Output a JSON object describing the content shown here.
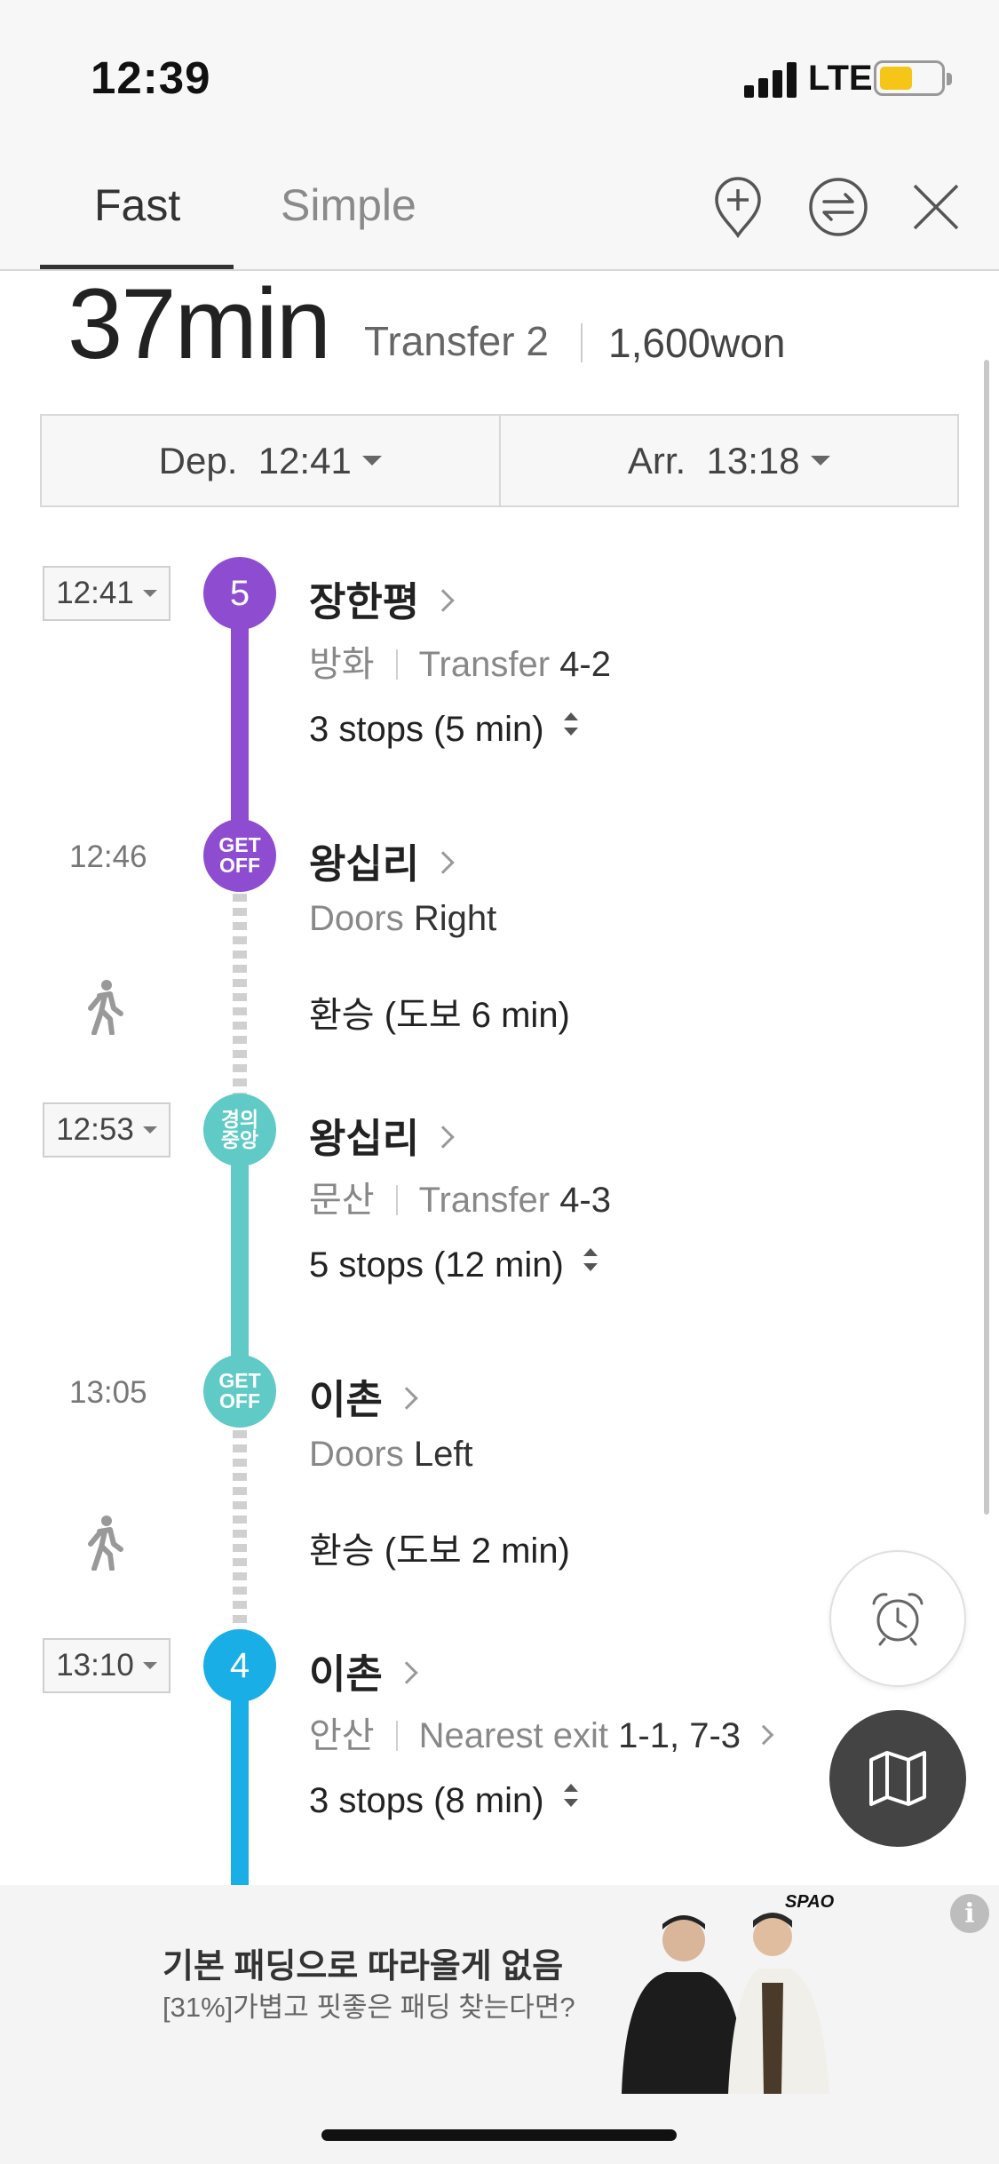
{
  "status_bar": {
    "time": "12:39",
    "network": "LTE"
  },
  "header": {
    "tabs": [
      {
        "label": "Fast"
      },
      {
        "label": "Simple"
      }
    ],
    "icons": [
      "add-location-icon",
      "swap-icon",
      "close-icon"
    ]
  },
  "summary": {
    "duration": "37min",
    "transfer": "Transfer 2",
    "fare": "1,600won"
  },
  "dep_arr": {
    "dep_label": "Dep.",
    "dep_time": "12:41",
    "arr_label": "Arr.",
    "arr_time": "13:18"
  },
  "colors": {
    "line5": "#8e4dd0",
    "gyeongui": "#5fcac6",
    "line4": "#1aaee6"
  },
  "route": [
    {
      "time": "12:41",
      "badge": "5",
      "station": "장한평",
      "direction": "방화",
      "info_label": "Transfer",
      "info_value": "4-2",
      "stops": "3 stops (5 min)"
    },
    {
      "time": "12:46",
      "badge_line1": "GET",
      "badge_line2": "OFF",
      "station": "왕십리",
      "doors_label": "Doors",
      "doors_value": "Right",
      "walk": "환승 (도보 6 min)"
    },
    {
      "time": "12:53",
      "badge_line1": "경의",
      "badge_line2": "중앙",
      "station": "왕십리",
      "direction": "문산",
      "info_label": "Transfer",
      "info_value": "4-3",
      "stops": "5 stops (12 min)"
    },
    {
      "time": "13:05",
      "badge_line1": "GET",
      "badge_line2": "OFF",
      "station": "이촌",
      "doors_label": "Doors",
      "doors_value": "Left",
      "walk": "환승 (도보 2 min)"
    },
    {
      "time": "13:10",
      "badge": "4",
      "station": "이촌",
      "direction": "안산",
      "info_label": "Nearest exit",
      "info_value": "1-1, 7-3",
      "stops": "3 stops (8 min)"
    }
  ],
  "ad": {
    "title": "기본 패딩으로 따라올게 없음",
    "subtitle": "[31%]가볍고 핏좋은 패딩 찾는다면?",
    "brand": "SPAO"
  }
}
